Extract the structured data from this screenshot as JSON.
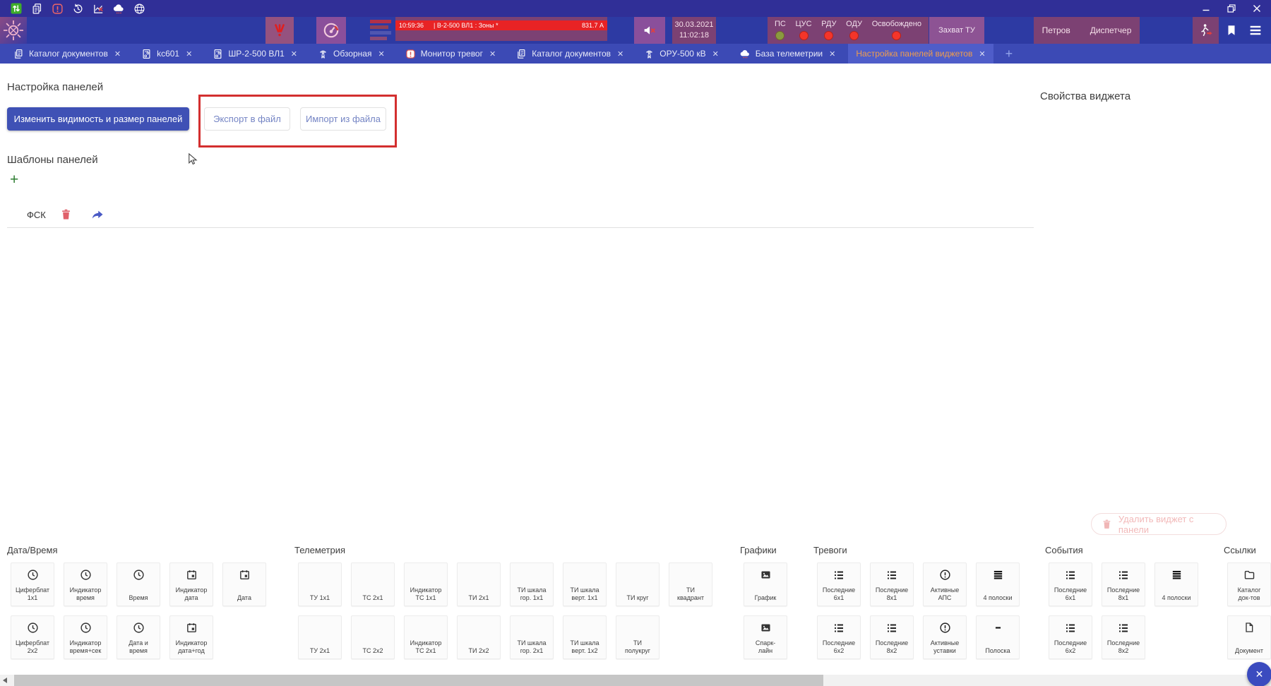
{
  "colors": {
    "accent": "#3f51b5",
    "header_purple": "#7c4173",
    "alarm_red": "#e82325",
    "annotation_red": "#d32f2f"
  },
  "titlebar": {
    "icons": [
      "panel-visibility",
      "copy-documents",
      "alarm-monitor",
      "history",
      "chart-disabled",
      "telemetry-cloud",
      "globe"
    ],
    "window_controls": [
      "minimize",
      "restore",
      "close"
    ]
  },
  "header": {
    "alarm_banner": {
      "time": "10:59:36",
      "message": "| В-2-500 ВЛ1 : Зоны *",
      "value": "831.7 А"
    },
    "date": "30.03.2021",
    "time": "11:02:18",
    "status_colors": {
      "ok": "#8a9a3f",
      "alarm": "#f4352a"
    },
    "statuses": [
      {
        "label": "ПС",
        "state": "ok"
      },
      {
        "label": "ЦУС",
        "state": "alarm"
      },
      {
        "label": "РДУ",
        "state": "alarm"
      },
      {
        "label": "ОДУ",
        "state": "alarm"
      },
      {
        "label": "Освобождено",
        "state": "alarm"
      }
    ],
    "capture_button": "Захват ТУ",
    "user": "Петров",
    "role": "Диспетчер"
  },
  "tabs": {
    "close_glyph": "✕",
    "add_glyph": "+",
    "items": [
      {
        "icon": "doc",
        "label": "Каталог документов",
        "active": false
      },
      {
        "icon": "schematic",
        "label": "kc601",
        "active": false
      },
      {
        "icon": "schematic",
        "label": "ШР-2-500 ВЛ1",
        "active": false
      },
      {
        "icon": "tower",
        "label": "Обзорная",
        "active": false
      },
      {
        "icon": "alarm",
        "label": "Монитор тревог",
        "active": false
      },
      {
        "icon": "doc",
        "label": "Каталог документов",
        "active": false
      },
      {
        "icon": "tower",
        "label": "ОРУ-500 кВ",
        "active": false
      },
      {
        "icon": "cloud",
        "label": "База телеметрии",
        "active": false
      },
      {
        "icon": "none",
        "label": "Настройка панелей виджетов",
        "active": true
      }
    ]
  },
  "main": {
    "panels_title": "Настройка панелей",
    "change_visibility_button": "Изменить видимость и размер панелей",
    "export_button": "Экспорт в файл",
    "import_button": "Импорт из файла",
    "templates_title": "Шаблоны панелей",
    "add_template_glyph": "+",
    "template_name": "ФСК",
    "widget_properties_title": "Свойства виджета",
    "delete_widget_button": "Удалить виджет с панели",
    "close_fab_glyph": "✕"
  },
  "palette": {
    "categories": [
      {
        "name": "Дата/Время",
        "rows": [
          [
            {
              "icon": "clock",
              "label": [
                "Циферблат",
                "1x1"
              ]
            },
            {
              "icon": "clock",
              "label": [
                "Индикатор",
                "время"
              ]
            },
            {
              "icon": "clock",
              "label": [
                "Время"
              ]
            },
            {
              "icon": "calendar",
              "label": [
                "Индикатор",
                "дата"
              ]
            },
            {
              "icon": "calendar",
              "label": [
                "Дата"
              ]
            }
          ],
          [
            {
              "icon": "clock",
              "label": [
                "Циферблат",
                "2x2"
              ]
            },
            {
              "icon": "clock",
              "label": [
                "Индикатор",
                "время+сек"
              ]
            },
            {
              "icon": "clock",
              "label": [
                "Дата и",
                "время"
              ]
            },
            {
              "icon": "calendar",
              "label": [
                "Индикатор",
                "дата+год"
              ]
            }
          ]
        ]
      },
      {
        "name": "Телеметрия",
        "rows": [
          [
            {
              "icon": "none",
              "label": [
                "ТУ 1x1"
              ]
            },
            {
              "icon": "none",
              "label": [
                "ТС 2x1"
              ]
            },
            {
              "icon": "none",
              "label": [
                "Индикатор",
                "ТС 1x1"
              ]
            },
            {
              "icon": "none",
              "label": [
                "ТИ 2x1"
              ]
            },
            {
              "icon": "none",
              "label": [
                "ТИ шкала",
                "гор. 1x1"
              ]
            },
            {
              "icon": "none",
              "label": [
                "ТИ шкала",
                "верт. 1x1"
              ]
            },
            {
              "icon": "none",
              "label": [
                "ТИ круг"
              ]
            },
            {
              "icon": "none",
              "label": [
                "ТИ",
                "квадрант"
              ]
            }
          ],
          [
            {
              "icon": "none",
              "label": [
                "ТУ 2x1"
              ]
            },
            {
              "icon": "none",
              "label": [
                "ТС 2x2"
              ]
            },
            {
              "icon": "none",
              "label": [
                "Индикатор",
                "ТС 2x1"
              ]
            },
            {
              "icon": "none",
              "label": [
                "ТИ 2x2"
              ]
            },
            {
              "icon": "none",
              "label": [
                "ТИ шкала",
                "гор. 2x1"
              ]
            },
            {
              "icon": "none",
              "label": [
                "ТИ шкала",
                "верт. 1x2"
              ]
            },
            {
              "icon": "none",
              "label": [
                "ТИ",
                "полукруг"
              ]
            }
          ]
        ]
      },
      {
        "name": "Графики",
        "rows": [
          [
            {
              "icon": "image",
              "label": [
                "График"
              ]
            }
          ],
          [
            {
              "icon": "image",
              "label": [
                "Спарк-",
                "лайн"
              ]
            }
          ]
        ]
      },
      {
        "name": "Тревоги",
        "rows": [
          [
            {
              "icon": "list",
              "label": [
                "Последние",
                "6x1"
              ]
            },
            {
              "icon": "list",
              "label": [
                "Последние",
                "8x1"
              ]
            },
            {
              "icon": "alert",
              "label": [
                "Активные",
                "АПС"
              ]
            },
            {
              "icon": "bars4",
              "label": [
                "4 полоски"
              ]
            }
          ],
          [
            {
              "icon": "list",
              "label": [
                "Последние",
                "6x2"
              ]
            },
            {
              "icon": "list",
              "label": [
                "Последние",
                "8x2"
              ]
            },
            {
              "icon": "alert",
              "label": [
                "Активные",
                "уставки"
              ]
            },
            {
              "icon": "dash",
              "label": [
                "Полоска"
              ]
            }
          ]
        ]
      },
      {
        "name": "События",
        "rows": [
          [
            {
              "icon": "list",
              "label": [
                "Последние",
                "6x1"
              ]
            },
            {
              "icon": "list",
              "label": [
                "Последние",
                "8x1"
              ]
            },
            {
              "icon": "bars4",
              "label": [
                "4 полоски"
              ]
            }
          ],
          [
            {
              "icon": "list",
              "label": [
                "Последние",
                "6x2"
              ]
            },
            {
              "icon": "list",
              "label": [
                "Последние",
                "8x2"
              ]
            }
          ]
        ]
      },
      {
        "name": "Ссылки",
        "rows": [
          [
            {
              "icon": "folder",
              "label": [
                "Каталог",
                "док-тов"
              ]
            }
          ],
          [
            {
              "icon": "document",
              "label": [
                "Документ"
              ]
            }
          ]
        ]
      }
    ]
  }
}
